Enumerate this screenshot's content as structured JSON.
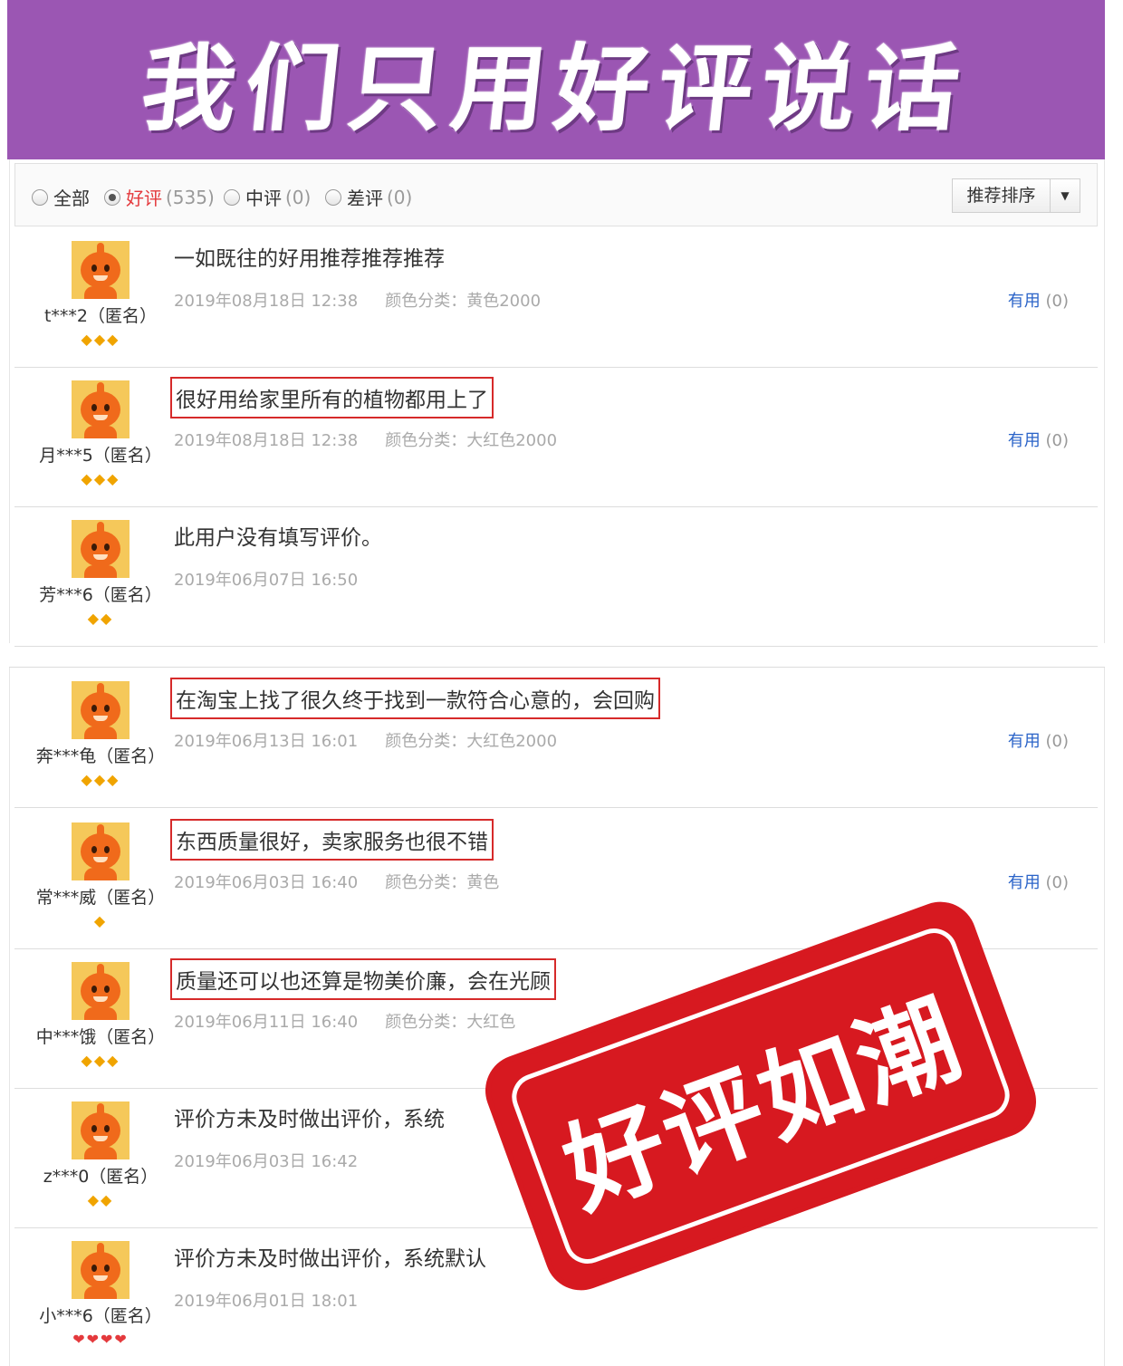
{
  "banner": {
    "title": "我们只用好评说话"
  },
  "filters": {
    "items": [
      {
        "label": "全部",
        "count": "",
        "checked": false
      },
      {
        "label": "好评",
        "count": "(535)",
        "checked": true
      },
      {
        "label": "中评",
        "count": "(0)",
        "checked": false
      },
      {
        "label": "差评",
        "count": "(0)",
        "checked": false
      }
    ],
    "sort_label": "推荐排序"
  },
  "reviews": [
    {
      "user": "t***2（匿名）",
      "rank": "◆◆◆",
      "content": "一如既往的好用推荐推荐推荐",
      "boxed": false,
      "date": "2019年08月18日 12:38",
      "color": "颜色分类：黄色2000",
      "useful_label": "有用",
      "useful_count": "(0)"
    },
    {
      "user": "月***5（匿名）",
      "rank": "◆◆◆",
      "content": "很好用给家里所有的植物都用上了",
      "boxed": true,
      "date": "2019年08月18日 12:38",
      "color": "颜色分类：大红色2000",
      "useful_label": "有用",
      "useful_count": "(0)"
    },
    {
      "user": "芳***6（匿名）",
      "rank": "◆◆",
      "content": "此用户没有填写评价。",
      "boxed": false,
      "date": "2019年06月07日 16:50",
      "color": "",
      "useful_label": "",
      "useful_count": ""
    },
    {
      "user": "奔***龟（匿名）",
      "rank": "◆◆◆",
      "content": "在淘宝上找了很久终于找到一款符合心意的，会回购",
      "boxed": true,
      "date": "2019年06月13日 16:01",
      "color": "颜色分类：大红色2000",
      "useful_label": "有用",
      "useful_count": "(0)"
    },
    {
      "user": "常***威（匿名）",
      "rank": "◆",
      "content": "东西质量很好，卖家服务也很不错",
      "boxed": true,
      "date": "2019年06月03日 16:40",
      "color": "颜色分类：黄色",
      "useful_label": "有用",
      "useful_count": "(0)"
    },
    {
      "user": "中***饿（匿名）",
      "rank": "◆◆◆",
      "content": "质量还可以也还算是物美价廉，会在光顾",
      "boxed": true,
      "date": "2019年06月11日 16:40",
      "color": "颜色分类：大红色",
      "useful_label": "",
      "useful_count": ""
    },
    {
      "user": "z***0（匿名）",
      "rank": "◆◆",
      "content": "评价方未及时做出评价，系统",
      "boxed": false,
      "date": "2019年06月03日 16:42",
      "color": "",
      "useful_label": "",
      "useful_count": ""
    },
    {
      "user": "小***6（匿名）",
      "rank": "❤❤❤❤",
      "content": "评价方未及时做出评价，系统默认",
      "boxed": false,
      "date": "2019年06月01日 18:01",
      "color": "",
      "useful_label": "",
      "useful_count": ""
    }
  ],
  "stamp": {
    "text": "好评如潮"
  },
  "colors": {
    "banner": "#9b56b3",
    "stamp": "#d71920",
    "highlight_box": "#d62a2a",
    "useful_link": "#2a63c8"
  }
}
